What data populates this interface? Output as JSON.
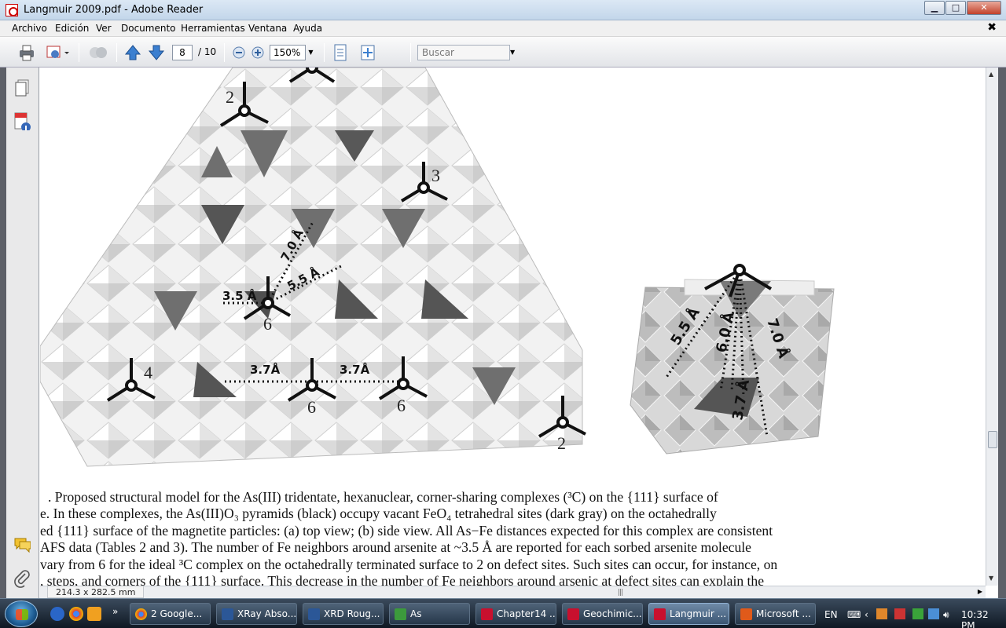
{
  "window": {
    "title": "Langmuir 2009.pdf - Adobe Reader",
    "buttons": {
      "minimize": "▁",
      "maximize": "□",
      "close": "✕"
    }
  },
  "menu": {
    "items": [
      "Archivo",
      "Edición",
      "Ver",
      "Documento",
      "Herramientas",
      "Ventana",
      "Ayuda"
    ],
    "doc_close": "✖"
  },
  "toolbar": {
    "page_current": "8",
    "page_total": "/ 10",
    "zoom": "150%",
    "search_placeholder": "Buscar"
  },
  "figure": {
    "top_view": {
      "labels": {
        "site_top_left": "2",
        "site_top_right": "3",
        "site_center": "6",
        "site_bottom_left": "4",
        "site_bottom_mid": "6",
        "site_bottom_right": "6",
        "site_defect": "2"
      },
      "distances": {
        "d1": "3.5 Å",
        "d2": "5.5 Å",
        "d3": "7.0 Å",
        "d4": "3.7Å",
        "d5": "3.7Å"
      }
    },
    "side_view": {
      "distances": {
        "d1": "5.5 Å",
        "d2": "6.0 Å",
        "d3": "7.0 Å",
        "d4": "3.7 Å"
      }
    }
  },
  "caption": {
    "lines": [
      ". Proposed structural model for the As(III) tridentate, hexanuclear, corner-sharing complexes (³C) on the {111} surface of",
      "e. In these complexes, the As(III)O₃ pyramids (black) occupy vacant FeO₄ tetrahedral sites (dark gray) on the octahedrally",
      "ed {111} surface of the magnetite particles: (a) top view; (b) side view. All As−Fe distances expected for this complex are consistent",
      "AFS data (Tables 2 and 3). The number of Fe neighbors around arsenite at ~3.5 Å are reported for each sorbed arsenite molecule",
      "vary from 6 for the ideal ³C complex on the octahedrally terminated surface to 2 on defect sites. Such sites can occur, for instance, on",
      ", steps, and corners of the {111} surface. This decrease in the number of Fe neighbors around arsenic at defect sites can explain the"
    ]
  },
  "statusbar": {
    "page_size": "214.3 x 282.5 mm"
  },
  "taskbar": {
    "tasks": [
      {
        "label": "2 Google...",
        "color": "#e8a317"
      },
      {
        "label": "XRay Abso...",
        "color": "#2b5797"
      },
      {
        "label": "XRD Roug...",
        "color": "#2b5797"
      },
      {
        "label": "As",
        "color": "#3c9a3c"
      },
      {
        "label": "Chapter14 ...",
        "color": "#c8102e"
      },
      {
        "label": "Geochimic...",
        "color": "#c8102e"
      },
      {
        "label": "Langmuir ...",
        "color": "#c8102e"
      },
      {
        "label": "Microsoft ...",
        "color": "#e05a1a"
      }
    ],
    "language": "EN",
    "clock": "10:32 PM"
  }
}
